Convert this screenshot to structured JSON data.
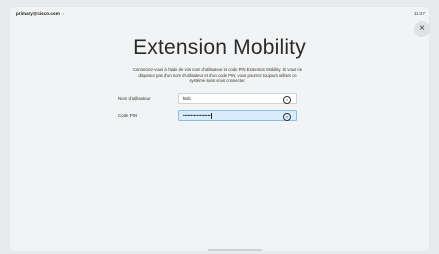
{
  "header": {
    "account": "primary@cisco.com",
    "account_chevron": ">",
    "time": "11:27",
    "close_symbol": "×"
  },
  "main": {
    "title": "Extension Mobility",
    "description": "Connectez-vous à l'aide de vos nom d'utilisateur et code PIN Extension Mobility. Si vous ne disposez pas d'un nom d'utilisateur et d'un code PIN, vous pourrez toujours utiliser ce système sans vous connecter.",
    "fields": [
      {
        "label": "Nom d'utilisateur",
        "value": "Bob",
        "clear_symbol": "×"
      },
      {
        "label": "Code PIN",
        "value": "••••••••••••••••••",
        "clear_symbol": "×"
      }
    ]
  },
  "colors": {
    "active_field_bg": "#d8ecfb",
    "active_field_border": "#88bfe6"
  }
}
